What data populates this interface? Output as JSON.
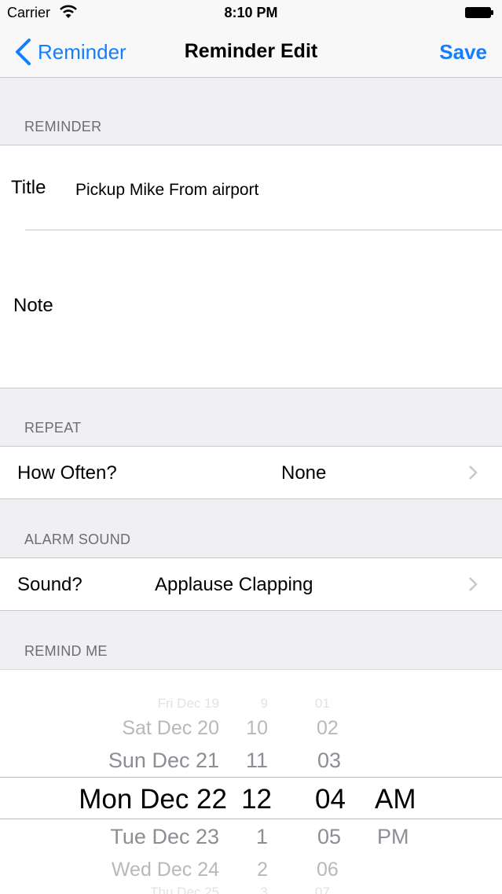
{
  "status_bar": {
    "carrier": "Carrier",
    "time": "8:10 PM"
  },
  "nav": {
    "back_label": "Reminder",
    "title": "Reminder Edit",
    "save_label": "Save"
  },
  "reminder_section": {
    "header": "REMINDER",
    "title_label": "Title",
    "title_value": "Pickup Mike From airport",
    "note_label": "Note",
    "note_value": ""
  },
  "repeat_section": {
    "header": "REPEAT",
    "label": "How Often?",
    "value": "None"
  },
  "alarm_section": {
    "header": "ALARM SOUND",
    "label": "Sound?",
    "value": "Applause Clapping"
  },
  "remind_section": {
    "header": "REMIND ME"
  },
  "date_picker": {
    "dates": [
      "Fri Dec 19",
      "Sat Dec 20",
      "Sun Dec 21",
      "Mon Dec 22",
      "Tue Dec 23",
      "Wed Dec 24",
      "Thu Dec 25"
    ],
    "hours": [
      "9",
      "10",
      "11",
      "12",
      "1",
      "2",
      "3"
    ],
    "minutes": [
      "01",
      "02",
      "03",
      "04",
      "05",
      "06",
      "07"
    ],
    "ampm": [
      "AM",
      "PM"
    ],
    "selected": {
      "date": "Mon Dec 22",
      "hour": "12",
      "minute": "04",
      "ampm": "AM"
    }
  },
  "colors": {
    "accent": "#157efb",
    "background": "#efeff4",
    "section_text": "#6d6d72",
    "separator": "#c8c7cc"
  }
}
